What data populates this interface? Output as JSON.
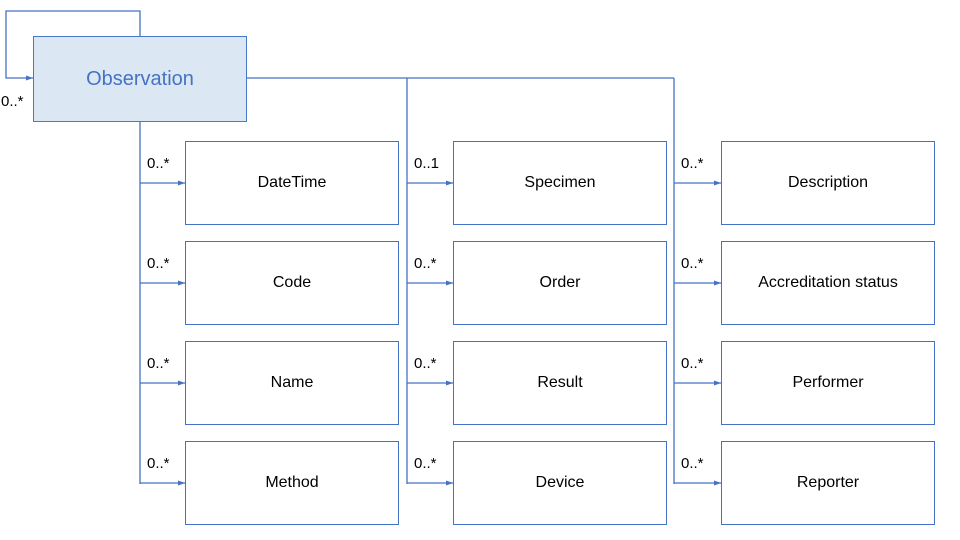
{
  "diagram": {
    "root": {
      "label": "Observation",
      "self_multiplicity": "0..*"
    },
    "columns": [
      {
        "items": [
          {
            "label": "DateTime",
            "multiplicity": "0..*"
          },
          {
            "label": "Code",
            "multiplicity": "0..*"
          },
          {
            "label": "Name",
            "multiplicity": "0..*"
          },
          {
            "label": "Method",
            "multiplicity": "0..*"
          }
        ]
      },
      {
        "items": [
          {
            "label": "Specimen",
            "multiplicity": "0..1"
          },
          {
            "label": "Order",
            "multiplicity": "0..*"
          },
          {
            "label": "Result",
            "multiplicity": "0..*"
          },
          {
            "label": "Device",
            "multiplicity": "0..*"
          }
        ]
      },
      {
        "items": [
          {
            "label": "Description",
            "multiplicity": "0..*"
          },
          {
            "label": "Accreditation status",
            "multiplicity": "0..*"
          },
          {
            "label": "Performer",
            "multiplicity": "0..*"
          },
          {
            "label": "Reporter",
            "multiplicity": "0..*"
          }
        ]
      }
    ],
    "colors": {
      "line": "#4472c4",
      "root_fill": "#dce7f4",
      "root_text": "#4472c4"
    }
  }
}
